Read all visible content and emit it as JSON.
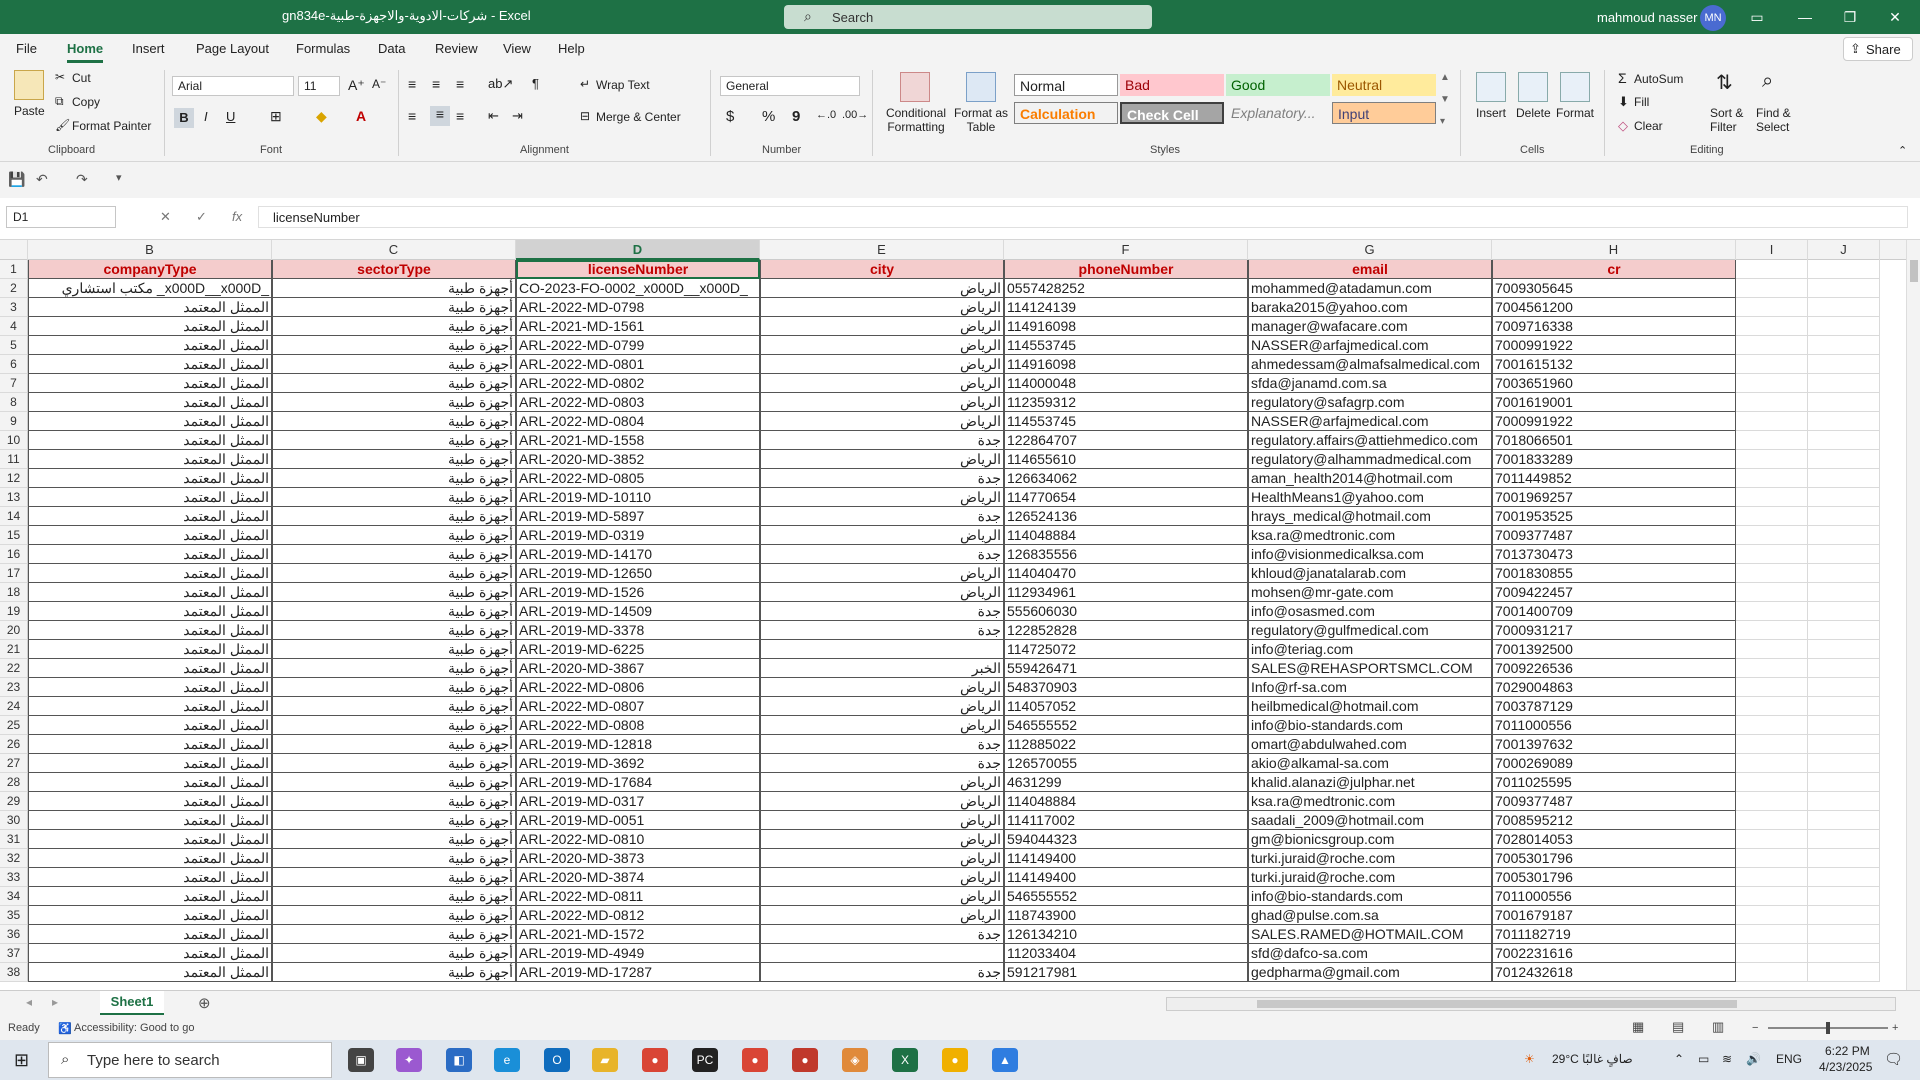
{
  "window": {
    "title": "gn834e-شركات-الادوية-والاجهزة-طبية  -  Excel",
    "search_placeholder": "Search",
    "user_name": "mahmoud nasser",
    "user_initials": "MN"
  },
  "tabs": [
    "File",
    "Home",
    "Insert",
    "Page Layout",
    "Formulas",
    "Data",
    "Review",
    "View",
    "Help"
  ],
  "active_tab": "Home",
  "share_label": "Share",
  "ribbon": {
    "clipboard": {
      "paste": "Paste",
      "cut": "Cut",
      "copy": "Copy",
      "format_painter": "Format Painter",
      "label": "Clipboard"
    },
    "font": {
      "name": "Arial",
      "size": "11",
      "bold": "B",
      "italic": "I",
      "underline": "U",
      "label": "Font"
    },
    "alignment": {
      "wrap_text": "Wrap Text",
      "merge_center": "Merge & Center",
      "label": "Alignment"
    },
    "number": {
      "format": "General",
      "currency": "$",
      "percent": "%",
      "comma": "9",
      "label": "Number"
    },
    "styles": {
      "conditional": "Conditional Formatting",
      "format_table": "Format as Table",
      "cells": [
        "Normal",
        "Bad",
        "Good",
        "Neutral",
        "Calculation",
        "Check Cell",
        "Explanatory...",
        "Input"
      ],
      "label": "Styles"
    },
    "cells": {
      "insert": "Insert",
      "delete": "Delete",
      "format": "Format",
      "label": "Cells"
    },
    "editing": {
      "autosum": "AutoSum",
      "fill": "Fill",
      "clear": "Clear",
      "sort_filter": "Sort & Filter",
      "find_select": "Find & Select",
      "label": "Editing"
    }
  },
  "formula_bar": {
    "name_box": "D1",
    "formula": "licenseNumber",
    "fx": "fx"
  },
  "columns": [
    "B",
    "C",
    "D",
    "E",
    "F",
    "G",
    "H",
    "I",
    "J"
  ],
  "selected_column": "D",
  "header_row": [
    "companyType",
    "sectorType",
    "licenseNumber",
    "city",
    "phoneNumber",
    "email",
    "cr"
  ],
  "rows": [
    [
      "مكتب استشاري _x000D__x000D_",
      "أجهزة طبية",
      "CO-2023-FO-0002_x000D__x000D_",
      "الرياض",
      "0557428252",
      "mohammed@atadamun.com",
      "7009305645"
    ],
    [
      "الممثل المعتمد",
      "أجهزة طبية",
      "ARL-2022-MD-0798",
      "الرياض",
      "114124139",
      "baraka2015@yahoo.com",
      "7004561200"
    ],
    [
      "الممثل المعتمد",
      "أجهزة طبية",
      "ARL-2021-MD-1561",
      "الرياض",
      "114916098",
      "manager@wafacare.com",
      "7009716338"
    ],
    [
      "الممثل المعتمد",
      "أجهزة طبية",
      "ARL-2022-MD-0799",
      "الرياض",
      "114553745",
      "NASSER@arfajmedical.com",
      "7000991922"
    ],
    [
      "الممثل المعتمد",
      "أجهزة طبية",
      "ARL-2022-MD-0801",
      "الرياض",
      "114916098",
      "ahmedessam@almafsalmedical.com",
      "7001615132"
    ],
    [
      "الممثل المعتمد",
      "أجهزة طبية",
      "ARL-2022-MD-0802",
      "الرياض",
      "114000048",
      "sfda@janamd.com.sa",
      "7003651960"
    ],
    [
      "الممثل المعتمد",
      "أجهزة طبية",
      "ARL-2022-MD-0803",
      "الرياض",
      "112359312",
      "regulatory@safagrp.com",
      "7001619001"
    ],
    [
      "الممثل المعتمد",
      "أجهزة طبية",
      "ARL-2022-MD-0804",
      "الرياض",
      "114553745",
      "NASSER@arfajmedical.com",
      "7000991922"
    ],
    [
      "الممثل المعتمد",
      "أجهزة طبية",
      "ARL-2021-MD-1558",
      "جدة",
      "122864707",
      "regulatory.affairs@attiehmedico.com",
      "7018066501"
    ],
    [
      "الممثل المعتمد",
      "أجهزة طبية",
      "ARL-2020-MD-3852",
      "الرياض",
      "114655610",
      "regulatory@alhammadmedical.com",
      "7001833289"
    ],
    [
      "الممثل المعتمد",
      "أجهزة طبية",
      "ARL-2022-MD-0805",
      "جدة",
      "126634062",
      "aman_health2014@hotmail.com",
      "7011449852"
    ],
    [
      "الممثل المعتمد",
      "أجهزة طبية",
      "ARL-2019-MD-10110",
      "الرياض",
      "114770654",
      "HealthMeans1@yahoo.com",
      "7001969257"
    ],
    [
      "الممثل المعتمد",
      "أجهزة طبية",
      "ARL-2019-MD-5897",
      "جدة",
      "126524136",
      "hrays_medical@hotmail.com",
      "7001953525"
    ],
    [
      "الممثل المعتمد",
      "أجهزة طبية",
      "ARL-2019-MD-0319",
      "الرياض",
      "114048884",
      "ksa.ra@medtronic.com",
      "7009377487"
    ],
    [
      "الممثل المعتمد",
      "أجهزة طبية",
      "ARL-2019-MD-14170",
      "جدة",
      "126835556",
      "info@visionmedicalksa.com",
      "7013730473"
    ],
    [
      "الممثل المعتمد",
      "أجهزة طبية",
      "ARL-2019-MD-12650",
      "الرياض",
      "114040470",
      "khloud@janatalarab.com",
      "7001830855"
    ],
    [
      "الممثل المعتمد",
      "أجهزة طبية",
      "ARL-2019-MD-1526",
      "الرياض",
      "112934961",
      "mohsen@mr-gate.com",
      "7009422457"
    ],
    [
      "الممثل المعتمد",
      "أجهزة طبية",
      "ARL-2019-MD-14509",
      "جدة",
      "555606030",
      "info@osasmed.com",
      "7001400709"
    ],
    [
      "الممثل المعتمد",
      "أجهزة طبية",
      "ARL-2019-MD-3378",
      "جدة",
      "122852828",
      "regulatory@gulfmedical.com",
      "7000931217"
    ],
    [
      "الممثل المعتمد",
      "أجهزة طبية",
      "ARL-2019-MD-6225",
      "",
      "114725072",
      "info@teriag.com",
      "7001392500"
    ],
    [
      "الممثل المعتمد",
      "أجهزة طبية",
      "ARL-2020-MD-3867",
      "الخبر",
      "559426471",
      "SALES@REHASPORTSMCL.COM",
      "7009226536"
    ],
    [
      "الممثل المعتمد",
      "أجهزة طبية",
      "ARL-2022-MD-0806",
      "الرياض",
      "548370903",
      "Info@rf-sa.com",
      "7029004863"
    ],
    [
      "الممثل المعتمد",
      "أجهزة طبية",
      "ARL-2022-MD-0807",
      "الرياض",
      "114057052",
      "heilbmedical@hotmail.com",
      "7003787129"
    ],
    [
      "الممثل المعتمد",
      "أجهزة طبية",
      "ARL-2022-MD-0808",
      "الرياض",
      "546555552",
      "info@bio-standards.com",
      "7011000556"
    ],
    [
      "الممثل المعتمد",
      "أجهزة طبية",
      "ARL-2019-MD-12818",
      "جدة",
      "112885022",
      "omart@abdulwahed.com",
      "7001397632"
    ],
    [
      "الممثل المعتمد",
      "أجهزة طبية",
      "ARL-2019-MD-3692",
      "جدة",
      "126570055",
      "akio@alkamal-sa.com",
      "7000269089"
    ],
    [
      "الممثل المعتمد",
      "أجهزة طبية",
      "ARL-2019-MD-17684",
      "الرياض",
      "4631299",
      "khalid.alanazi@julphar.net",
      "7011025595"
    ],
    [
      "الممثل المعتمد",
      "أجهزة طبية",
      "ARL-2019-MD-0317",
      "الرياض",
      "114048884",
      "ksa.ra@medtronic.com",
      "7009377487"
    ],
    [
      "الممثل المعتمد",
      "أجهزة طبية",
      "ARL-2019-MD-0051",
      "الرياض",
      "114117002",
      "saadali_2009@hotmail.com",
      "7008595212"
    ],
    [
      "الممثل المعتمد",
      "أجهزة طبية",
      "ARL-2022-MD-0810",
      "الرياض",
      "594044323",
      "gm@bionicsgroup.com",
      "7028014053"
    ],
    [
      "الممثل المعتمد",
      "أجهزة طبية",
      "ARL-2020-MD-3873",
      "الرياض",
      "114149400",
      "turki.juraid@roche.com",
      "7005301796"
    ],
    [
      "الممثل المعتمد",
      "أجهزة طبية",
      "ARL-2020-MD-3874",
      "الرياض",
      "114149400",
      "turki.juraid@roche.com",
      "7005301796"
    ],
    [
      "الممثل المعتمد",
      "أجهزة طبية",
      "ARL-2022-MD-0811",
      "الرياض",
      "546555552",
      "info@bio-standards.com",
      "7011000556"
    ],
    [
      "الممثل المعتمد",
      "أجهزة طبية",
      "ARL-2022-MD-0812",
      "الرياض",
      "118743900",
      "ghad@pulse.com.sa",
      "7001679187"
    ],
    [
      "الممثل المعتمد",
      "أجهزة طبية",
      "ARL-2021-MD-1572",
      "جدة",
      "126134210",
      "SALES.RAMED@HOTMAIL.COM",
      "7011182719"
    ],
    [
      "الممثل المعتمد",
      "أجهزة طبية",
      "ARL-2019-MD-4949",
      "",
      "112033404",
      "sfd@dafco-sa.com",
      "7002231616"
    ],
    [
      "الممثل المعتمد",
      "أجهزة طبية",
      "ARL-2019-MD-17287",
      "جدة",
      "591217981",
      "gedpharma@gmail.com",
      "7012432618"
    ]
  ],
  "sheet_tab": "Sheet1",
  "status": {
    "ready": "Ready",
    "accessibility": "Accessibility: Good to go",
    "zoom": "100%"
  },
  "taskbar": {
    "search_placeholder": "Type here to search",
    "weather": "29°C  صافٍ غالبًا",
    "lang": "ENG",
    "time": "6:22 PM",
    "date": "4/23/2025"
  },
  "colors": {
    "excel_green": "#1e7145",
    "header_fill": "#f4cccc",
    "header_text": "#c00000"
  }
}
